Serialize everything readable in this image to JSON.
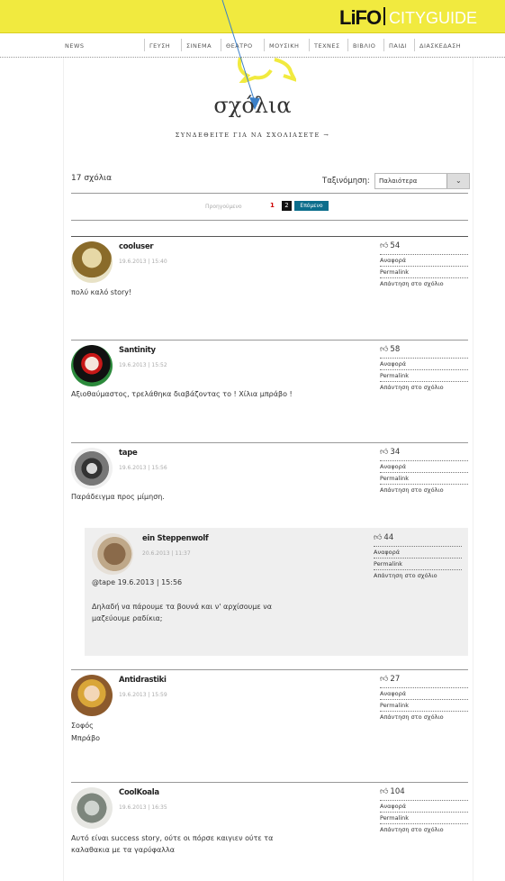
{
  "header": {
    "logo": "LiFO",
    "logo_sub": "CITYGUIDE",
    "nav": [
      "NEWS",
      "ΓΕΥΣΗ",
      "ΣΙΝΕΜΑ",
      "ΘΕΑΤΡΟ",
      "ΜΟΥΣΙΚΗ",
      "ΤΕΧΝΕΣ",
      "ΒΙΒΛΙΟ",
      "ΠΑΙΔΙ",
      "ΔΙΑΣΚΕΔΑΣΗ"
    ]
  },
  "page": {
    "title": "σχόλια",
    "login_link": "ΣΥΝΔΕΘΕΙΤΕ ΓΙΑ ΝΑ ΣΧΟΛΙΑΣΕΤΕ →",
    "count": "17 σχόλια",
    "sort_label": "Ταξινόμηση:",
    "sort_value": "Παλαιότερα",
    "pager": {
      "prev": "Προηγούμενο",
      "p1": "1",
      "p2": "2",
      "next": "Επόμενο"
    }
  },
  "actions": {
    "report": "Αναφορά",
    "permalink": "Permalink",
    "reply": "Απάντηση στο σχόλιο"
  },
  "comments": [
    {
      "user": "cooluser",
      "date": "19.6.2013 | 15:40",
      "likes": "54",
      "text": [
        "πολύ καλό story!"
      ]
    },
    {
      "user": "Santinity",
      "date": "19.6.2013 | 15:52",
      "likes": "58",
      "text": [
        "Αξιοθαύμαστος, τρελάθηκα διαβάζοντας το ! Χίλια μπράβο !"
      ]
    },
    {
      "user": "tape",
      "date": "19.6.2013 | 15:56",
      "likes": "34",
      "text": [
        "Παράδειγμα προς μίμηση."
      ]
    },
    {
      "user": "ein Steppenwolf",
      "date": "20.6.2013 | 11:37",
      "likes": "44",
      "text": [
        "@tape 19.6.2013 | 15:56",
        "",
        "Δηλαδή να πάρουμε τα βουνά και ν' αρχίσουμε να",
        "μαζεύουμε ραδίκια;"
      ]
    },
    {
      "user": "Antidrastiki",
      "date": "19.6.2013 | 15:59",
      "likes": "27",
      "text": [
        "Σοφός",
        "Μπράβο"
      ]
    },
    {
      "user": "CoolKoala",
      "date": "19.6.2013 | 16:35",
      "likes": "104",
      "text": [
        "Αυτό είναι success story, ούτε οι πόρσε καιγιεν ούτε τα",
        "καλαθακια με τα γαρύφαλλα"
      ]
    }
  ],
  "colors": {
    "topbar": "#f1ea3f",
    "next_button": "#0b6d8c",
    "current_page": "#c00000"
  }
}
